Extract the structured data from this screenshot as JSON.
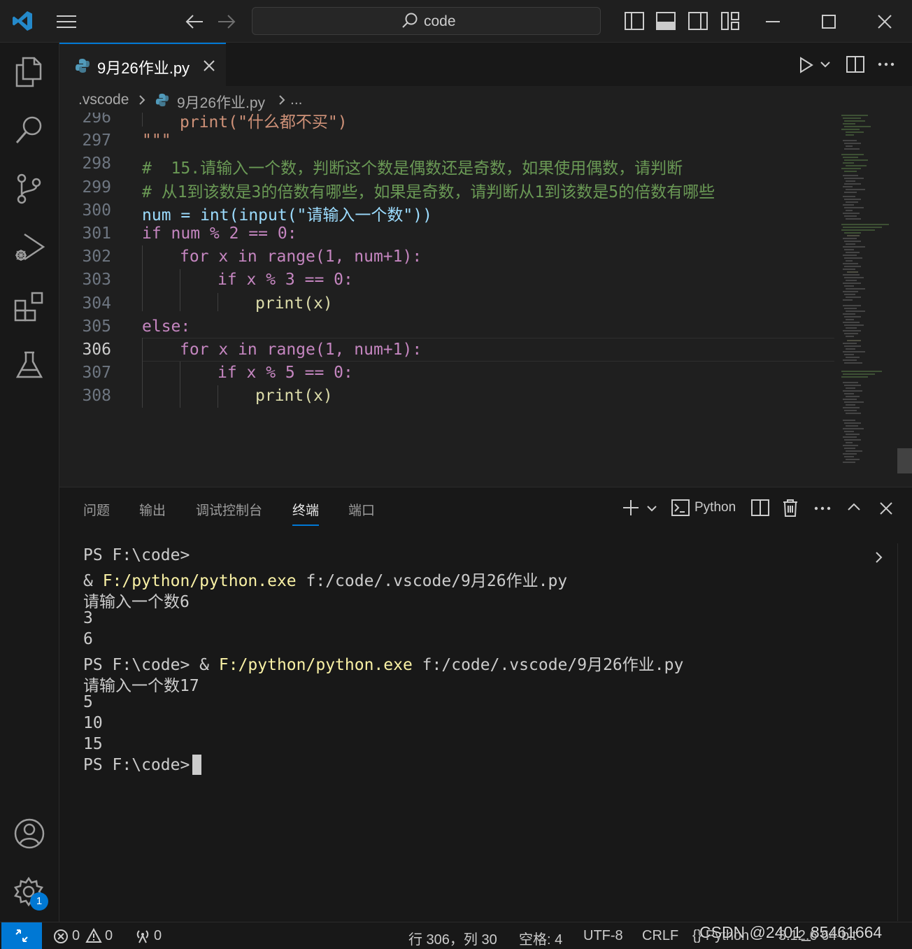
{
  "titlebar": {
    "search_text": "code"
  },
  "tab": {
    "filename": "9月26作业.py"
  },
  "breadcrumb": {
    "folder": ".vscode",
    "file": "9月26作业.py",
    "more": "..."
  },
  "editor": {
    "line_numbers": [
      "296",
      "297",
      "298",
      "299",
      "300",
      "301",
      "302",
      "303",
      "304",
      "305",
      "306",
      "307",
      "308"
    ],
    "current_line": "306",
    "lines": {
      "l296": "print(\"什么都不买\")",
      "l297": "\"\"\"",
      "l298": "#  15.请输入一个数，判断这个数是偶数还是奇数，如果使用偶数，请判断",
      "l299": "# 从1到该数是3的倍数有哪些，如果是奇数，请判断从1到该数是5的倍数有哪些",
      "l300": "num = int(input(\"请输入一个数\"))",
      "l301": "if num % 2 == 0:",
      "l302": "for x in range(1, num+1):",
      "l303": "if x % 3 == 0:",
      "l304": "print(x)",
      "l305": "else:",
      "l306": "for x in range(1, num+1):",
      "l307": "if x % 5 == 0:",
      "l308": "print(x)"
    }
  },
  "panel": {
    "tabs": [
      "问题",
      "输出",
      "调试控制台",
      "终端",
      "端口"
    ],
    "active_tab": "终端",
    "terminal_profile": "Python",
    "terminal": {
      "l1": "PS F:\\code>",
      "l2_amp": "& ",
      "l2_exe": "F:/python/python.exe",
      "l2_arg": " f:/code/.vscode/9月26作业.py",
      "l3": "请输入一个数6",
      "l4": "3",
      "l5": "6",
      "l6_prompt": "PS F:\\code> & ",
      "l6_exe": "F:/python/python.exe",
      "l6_arg": " f:/code/.vscode/9月26作业.py",
      "l7": "请输入一个数17",
      "l8": "5",
      "l9": "10",
      "l10": "15",
      "l11": "PS F:\\code> "
    }
  },
  "statusbar": {
    "errors": "0",
    "warnings": "0",
    "ports": "0",
    "position": "行 306，列 30",
    "spaces": "空格: 4",
    "encoding": "UTF-8",
    "eol": "CRLF",
    "language": "{} Python",
    "interpreter": "3.12.6 64-bit",
    "watermark": "CSDN @2401_85461664"
  },
  "activity": {
    "settings_badge": "1"
  },
  "colors": {
    "accent": "#0078d4",
    "background": "#1f1f1f",
    "sidebar": "#181818"
  }
}
